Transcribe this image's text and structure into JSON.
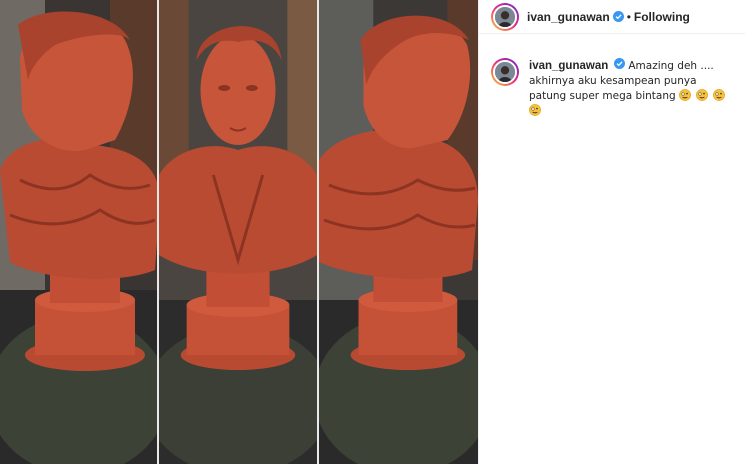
{
  "post": {
    "media": {
      "panels": [
        "bust-left-profile",
        "bust-front",
        "bust-right-profile"
      ],
      "colors": {
        "clay": "#c8533a",
        "clay_shadow": "#8c3421",
        "background": "#2b2b2b"
      }
    },
    "header": {
      "username": "ivan_gunawan",
      "verified_icon": "verified-badge-icon",
      "separator": "•",
      "follow_state": "Following"
    },
    "caption": {
      "username": "ivan_gunawan",
      "verified_icon": "verified-badge-icon",
      "text": "Amazing deh .... akhirnya aku kesampean punya patung super mega bintang",
      "emojis": [
        "zany-face-emoji",
        "zany-face-emoji",
        "zany-face-emoji",
        "zany-face-emoji"
      ]
    },
    "colors": {
      "verified_blue": "#3897f0",
      "text": "#262626",
      "border": "#efefef"
    }
  }
}
